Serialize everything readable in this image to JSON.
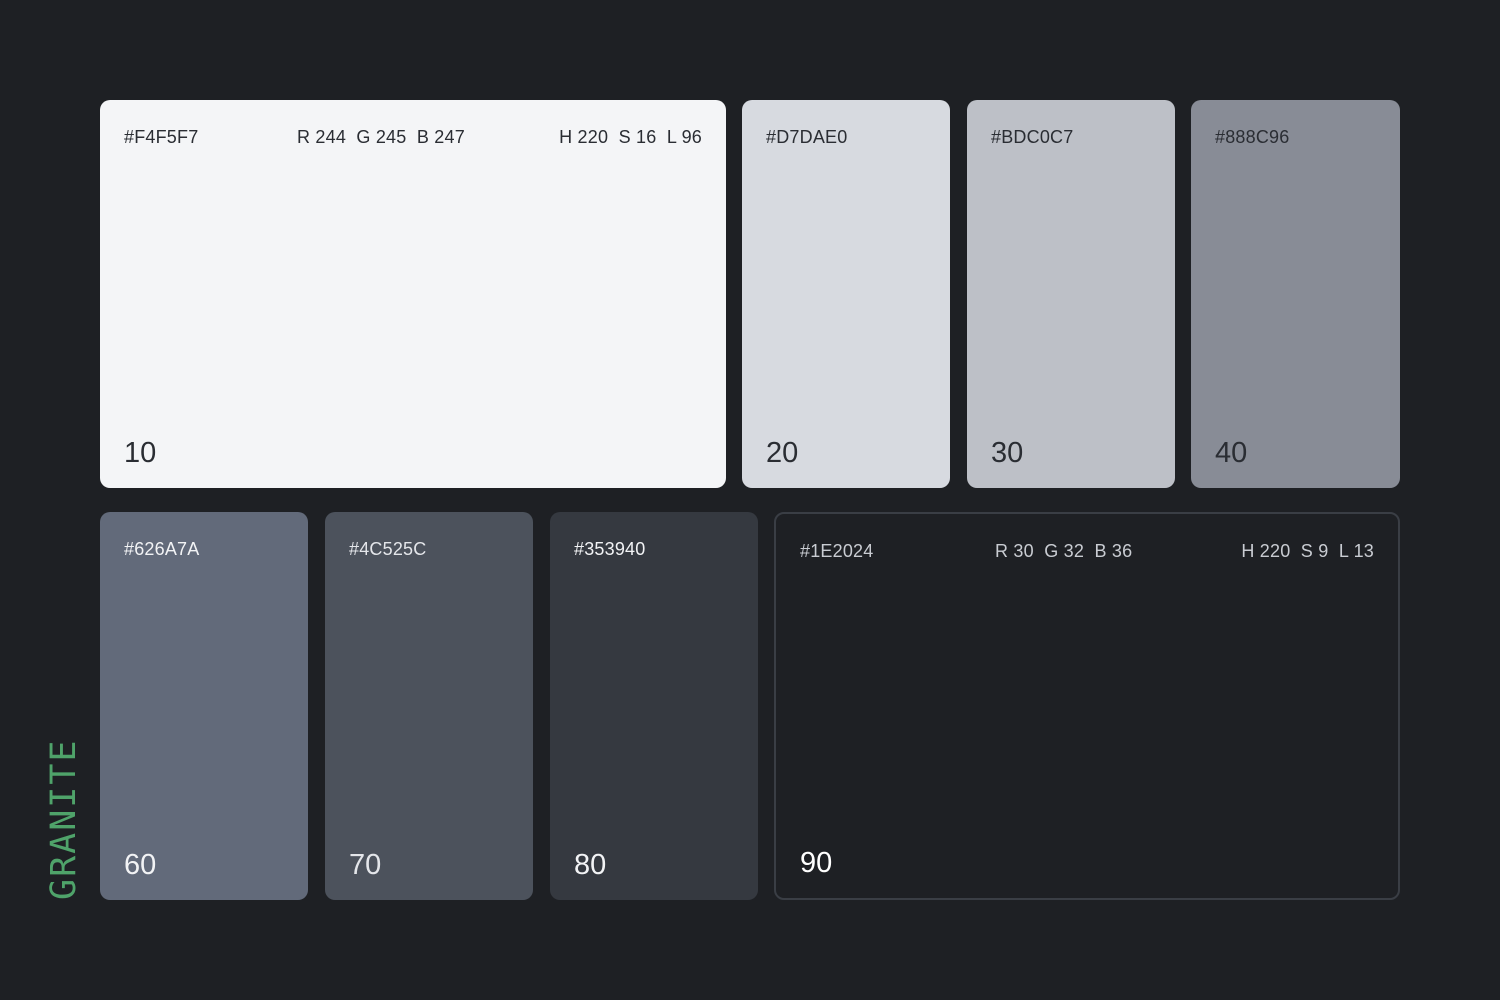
{
  "palette": {
    "name": "GRANITE",
    "name_color": "#4FA36A"
  },
  "swatches": [
    {
      "step": "10",
      "hex": "#F4F5F7",
      "fill": "#F4F5F7",
      "rgb": "R 244  G 245  B 247",
      "hsl": "H 220  S 16  L 96",
      "text_color": "#2A2D33"
    },
    {
      "step": "20",
      "hex": "#D7DAE0",
      "fill": "#D7DAE0",
      "text_color": "#2A2D33"
    },
    {
      "step": "30",
      "hex": "#BDC0C7",
      "fill": "#BDC0C7",
      "text_color": "#2A2D33"
    },
    {
      "step": "40",
      "hex": "#888C96",
      "fill": "#888C96",
      "text_color": "#2A2D33"
    },
    {
      "step": "60",
      "hex": "#626A7A",
      "fill": "#626A7A",
      "text_color": "#F2F3F5"
    },
    {
      "step": "70",
      "hex": "#4C525C",
      "fill": "#4C525C",
      "text_color": "#E4E6EA"
    },
    {
      "step": "80",
      "hex": "#353940",
      "fill": "#353940",
      "text_color": "#F2F3F5"
    },
    {
      "step": "90",
      "hex": "#1E2024",
      "fill": "#1E2024",
      "rgb": "R 30  G 32  B 36",
      "hsl": "H 220  S 9  L 13",
      "text_color": "#C9CCD2",
      "step_color": "#FFFFFF",
      "border_color": "#3A3E45"
    }
  ]
}
